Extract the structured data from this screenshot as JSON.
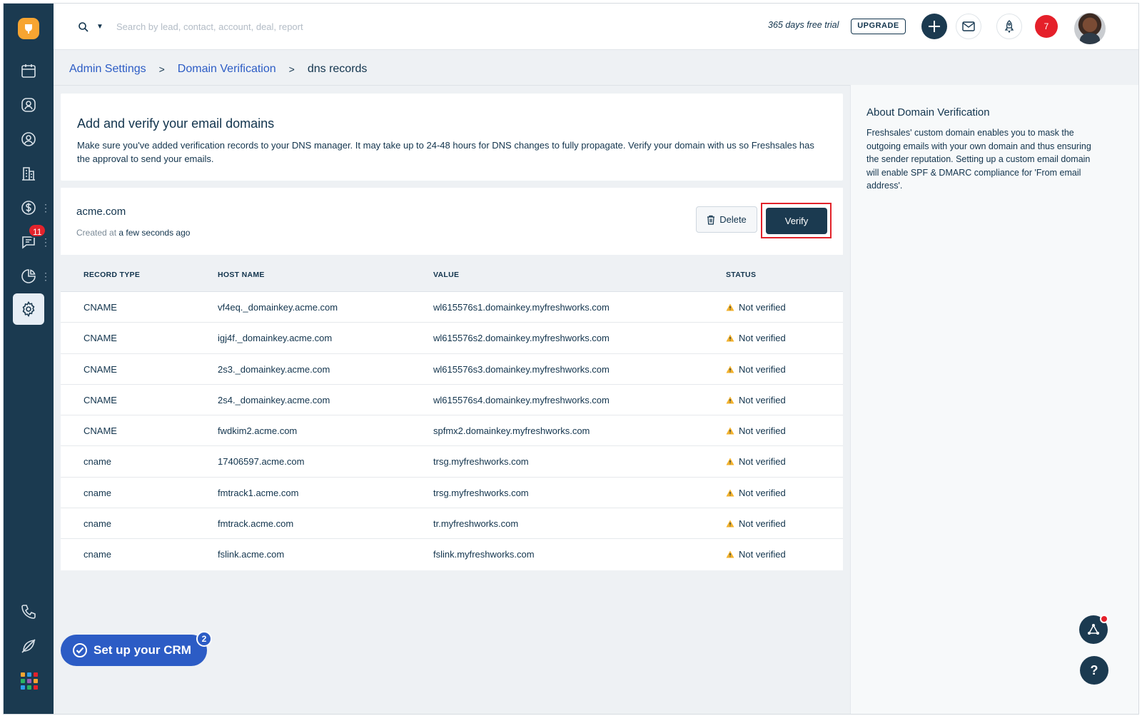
{
  "nav": {
    "items": [
      {
        "icon": "calendar-icon"
      },
      {
        "icon": "contacts-icon"
      },
      {
        "icon": "user-icon"
      },
      {
        "icon": "accounts-building-icon"
      },
      {
        "icon": "deals-dollar-icon"
      },
      {
        "icon": "chat-icon",
        "badge": "11"
      },
      {
        "icon": "reports-pie-icon"
      },
      {
        "icon": "settings-gear-icon",
        "active": true
      }
    ],
    "bottom": [
      "phone-icon",
      "leaf-off-icon",
      "apps-grid-icon"
    ]
  },
  "topbar": {
    "search_placeholder": "Search by lead, contact, account, deal, report",
    "trial_text": "365 days free trial",
    "upgrade_label": "UPGRADE",
    "notification_count": "7"
  },
  "breadcrumb": {
    "items": [
      "Admin Settings",
      "Domain Verification"
    ],
    "current": "dns records"
  },
  "intro": {
    "title": "Add and verify your email domains",
    "description": "Make sure you've added verification records to your DNS manager. It may take up to 24-48 hours for DNS changes to fully propagate. Verify your domain with us so Freshsales has the approval to send your emails."
  },
  "domain": {
    "name": "acme.com",
    "created_prefix": "Created at",
    "created_value": "a few seconds ago",
    "delete_label": "Delete",
    "verify_label": "Verify"
  },
  "table": {
    "headers": [
      "RECORD TYPE",
      "HOST NAME",
      "VALUE",
      "STATUS"
    ],
    "rows": [
      [
        "CNAME",
        "vf4eq._domainkey.acme.com",
        "wl615576s1.domainkey.myfreshworks.com",
        "Not verified"
      ],
      [
        "CNAME",
        "igj4f._domainkey.acme.com",
        "wl615576s2.domainkey.myfreshworks.com",
        "Not verified"
      ],
      [
        "CNAME",
        "2s3._domainkey.acme.com",
        "wl615576s3.domainkey.myfreshworks.com",
        "Not verified"
      ],
      [
        "CNAME",
        "2s4._domainkey.acme.com",
        "wl615576s4.domainkey.myfreshworks.com",
        "Not verified"
      ],
      [
        "CNAME",
        "fwdkim2.acme.com",
        "spfmx2.domainkey.myfreshworks.com",
        "Not verified"
      ],
      [
        "cname",
        "17406597.acme.com",
        "trsg.myfreshworks.com",
        "Not verified"
      ],
      [
        "cname",
        "fmtrack1.acme.com",
        "trsg.myfreshworks.com",
        "Not verified"
      ],
      [
        "cname",
        "fmtrack.acme.com",
        "tr.myfreshworks.com",
        "Not verified"
      ],
      [
        "cname",
        "fslink.acme.com",
        "fslink.myfreshworks.com",
        "Not verified"
      ]
    ]
  },
  "about": {
    "title": "About Domain Verification",
    "text": "Freshsales' custom domain enables you to mask the outgoing emails with your own domain and thus ensuring the sender reputation. Setting up a custom email domain will enable SPF & DMARC compliance for 'From email address'."
  },
  "setup": {
    "label": "Set up your CRM",
    "badge": "2"
  },
  "help_label": "?",
  "colors": {
    "nav_bg": "#1b3a50",
    "accent_blue": "#2c5cc5",
    "verify_bg": "#1b3a50",
    "highlight_red": "#e2222a",
    "warning_yellow": "#f3b12b"
  }
}
